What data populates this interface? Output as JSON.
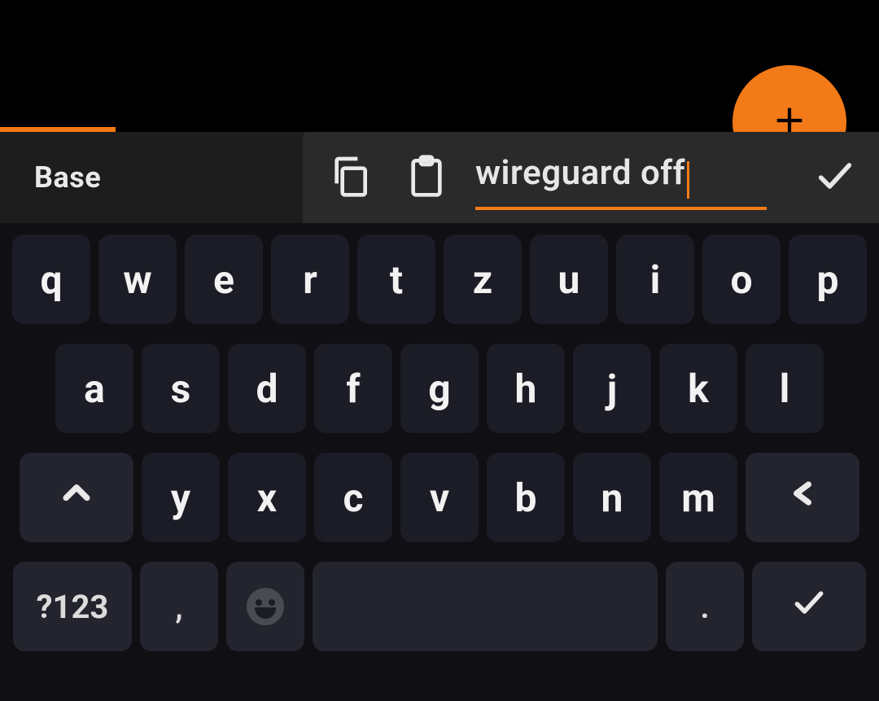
{
  "colors": {
    "accent": "#f37a18",
    "bg": "#000000",
    "toolbar": "#1d1d1d",
    "editor": "#2a2a2a",
    "keyboard_bg": "#0f0f14",
    "key_bg": "#1b1c25",
    "key_dim_bg": "#23242d",
    "text": "#e6e6e6"
  },
  "fab": {
    "icon": "plus-icon"
  },
  "toolbar": {
    "title": "Base",
    "copy_icon": "copy-icon",
    "paste_icon": "clipboard-icon",
    "input_value": "wireguard off",
    "confirm_icon": "check-icon"
  },
  "keyboard": {
    "row1": [
      "q",
      "w",
      "e",
      "r",
      "t",
      "z",
      "u",
      "i",
      "o",
      "p"
    ],
    "row2": [
      "a",
      "s",
      "d",
      "f",
      "g",
      "h",
      "j",
      "k",
      "l"
    ],
    "row3_letters": [
      "y",
      "x",
      "c",
      "v",
      "b",
      "n",
      "m"
    ],
    "shift_icon": "shift-icon",
    "backspace_icon": "backspace-icon",
    "symbols_label": "?123",
    "comma_label": ",",
    "emoji_icon": "emoji-icon",
    "period_label": ".",
    "enter_icon": "check-icon"
  }
}
